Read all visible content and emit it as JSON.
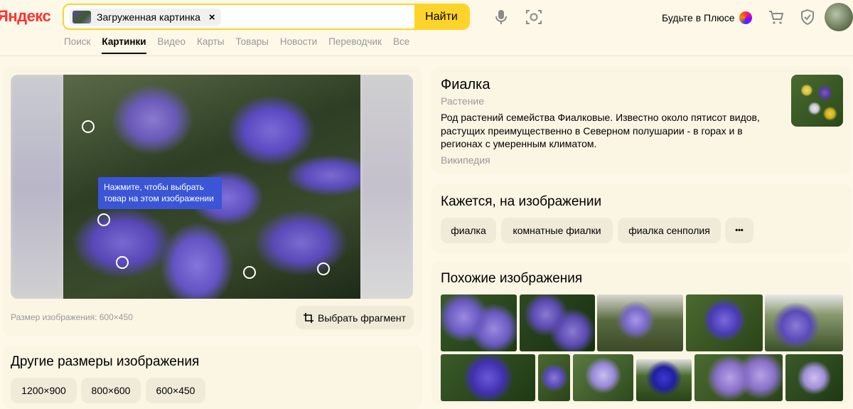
{
  "header": {
    "logo": "Яндекс",
    "search_chip": "Загруженная картинка",
    "chip_close": "×",
    "find_button": "Найти",
    "plus_text": "Будьте в Плюсе"
  },
  "nav": [
    "Поиск",
    "Картинки",
    "Видео",
    "Карты",
    "Товары",
    "Новости",
    "Переводчик",
    "Все"
  ],
  "viewer": {
    "tooltip": "Нажмите, чтобы выбрать товар на этом изображении",
    "size_text": "Размер изображения: 600×450",
    "fragment_button": "Выбрать фрагмент"
  },
  "other_sizes": {
    "title": "Другие размеры изображения",
    "sizes": [
      "1200×900",
      "800×600",
      "600×450"
    ]
  },
  "wiki": {
    "title": "Фиалка",
    "subtitle": "Растение",
    "description": "Род растений семейства Фиалковые. Известно около пятисот видов, растущих преимущественно в Северном полушарии - в горах и в регионах с умеренным климатом.",
    "source": "Википедия"
  },
  "tags": {
    "title": "Кажется, на изображении",
    "items": [
      "фиалка",
      "комнатные фиалки",
      "фиалка сенполия"
    ],
    "more": "•••"
  },
  "similar": {
    "title": "Похожие изображения"
  },
  "icons": [
    "mic-icon",
    "camera-lens-icon",
    "cart-icon",
    "shield-icon",
    "crop-icon"
  ]
}
